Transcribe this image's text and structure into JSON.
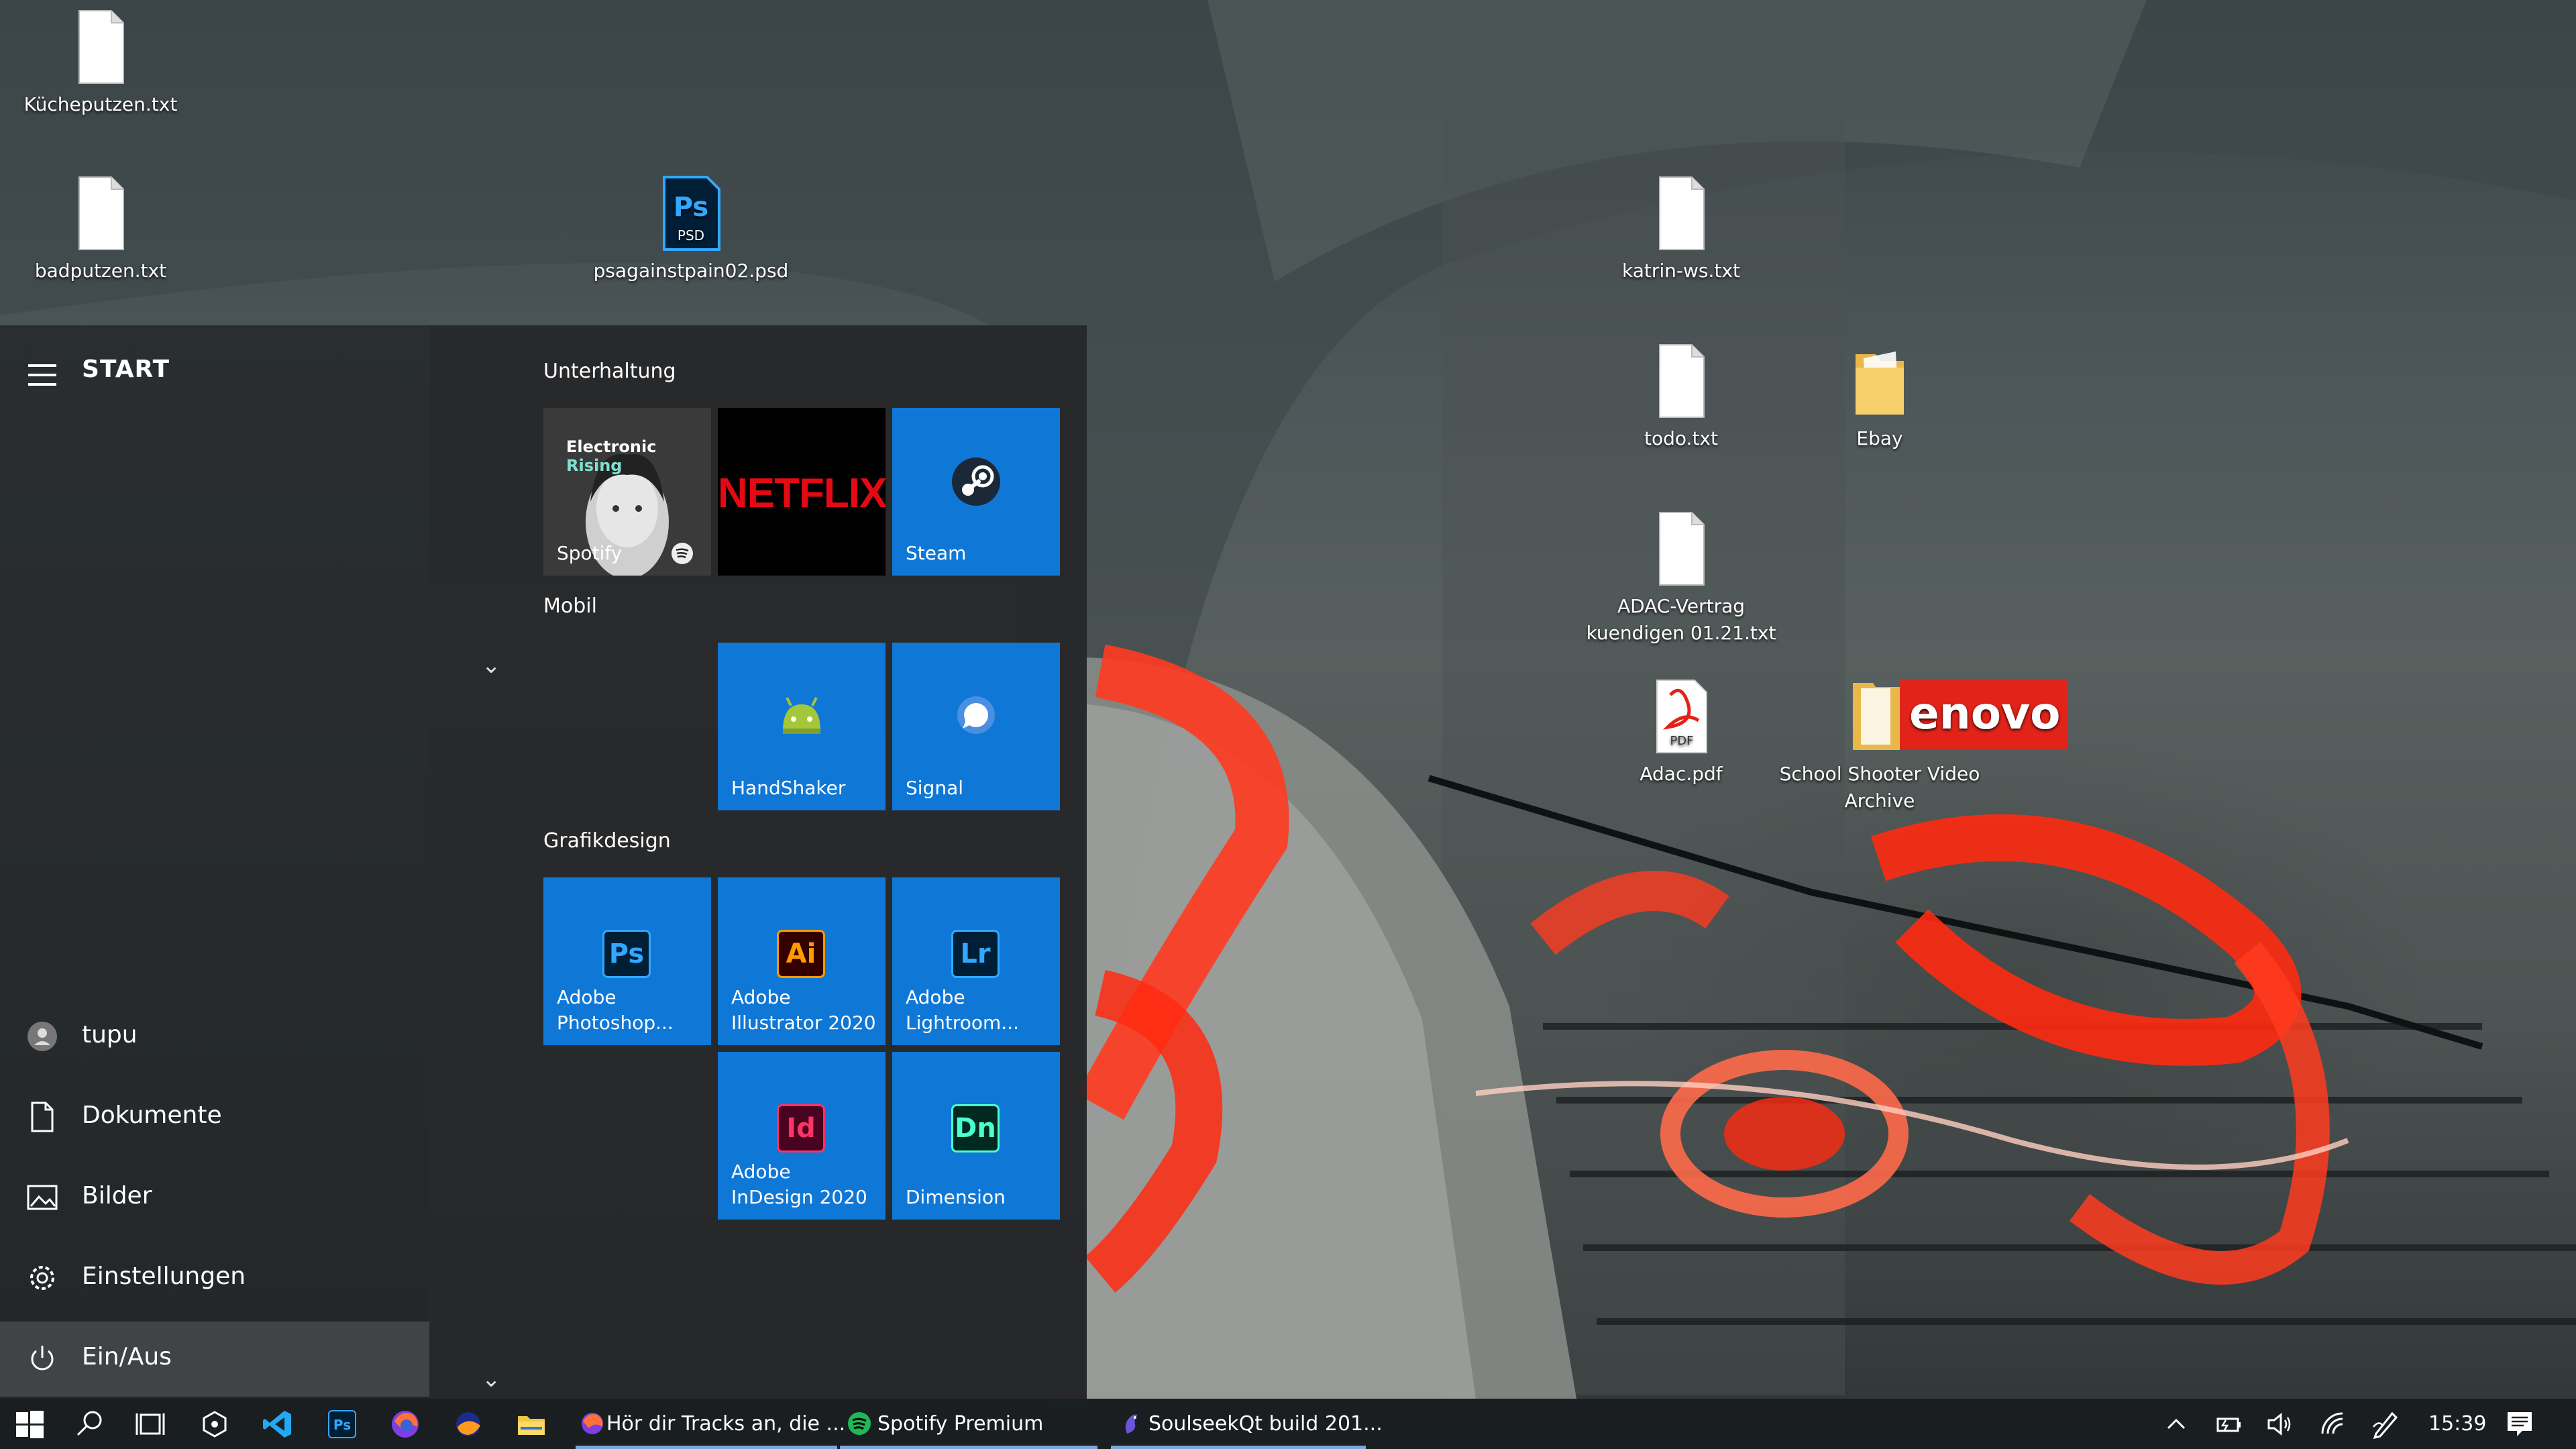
{
  "desktop": {
    "icons": [
      {
        "id": "kuecheputzen",
        "label": "Kücheputzen.txt"
      },
      {
        "id": "badputzen",
        "label": "badputzen.txt"
      },
      {
        "id": "psd",
        "label": "psagainstpain02.psd"
      },
      {
        "id": "katrin",
        "label": "katrin-ws.txt"
      },
      {
        "id": "todo",
        "label": "todo.txt"
      },
      {
        "id": "ebay",
        "label": "Ebay"
      },
      {
        "id": "adac-vertrag",
        "label": "ADAC-Vertrag kuendigen 01.21.txt"
      },
      {
        "id": "adac-pdf",
        "label": "Adac.pdf"
      },
      {
        "id": "school",
        "label": "School Shooter Video Archive"
      }
    ],
    "psd_badge": "PSD",
    "pdf_badge": "PDF",
    "lenovo_text": "enovo"
  },
  "start": {
    "title": "START",
    "user": "tupu",
    "items": [
      {
        "label": "Dokumente"
      },
      {
        "label": "Bilder"
      },
      {
        "label": "Einstellungen"
      },
      {
        "label": "Ein/Aus"
      }
    ],
    "groups": [
      {
        "title": "Unterhaltung"
      },
      {
        "title": "Mobil"
      },
      {
        "title": "Grafikdesign"
      }
    ],
    "tiles": {
      "spotify": {
        "label": "Spotify",
        "banner": "Electronic",
        "banner_accent": "Rising"
      },
      "netflix": {
        "label": "NETFLIX"
      },
      "steam": {
        "label": "Steam"
      },
      "handshaker": {
        "label": "HandShaker"
      },
      "signal": {
        "label": "Signal"
      },
      "photoshop": {
        "label_1": "Adobe",
        "label_2": "Photoshop...",
        "glyph": "Ps"
      },
      "illustrator": {
        "label_1": "Adobe",
        "label_2": "Illustrator 2020",
        "glyph": "Ai"
      },
      "lightroom": {
        "label_1": "Adobe",
        "label_2": "Lightroom...",
        "glyph": "Lr"
      },
      "indesign": {
        "label_1": "Adobe",
        "label_2": "InDesign 2020",
        "glyph": "Id"
      },
      "dimension": {
        "label": "Dimension",
        "glyph": "Dn"
      }
    }
  },
  "taskbar": {
    "tasks": [
      {
        "label": "Hör dir Tracks an, die ..."
      },
      {
        "label": "Spotify Premium"
      },
      {
        "label": "SoulseekQt build 201..."
      }
    ],
    "clock": "15:39",
    "pinned_glyphs": {
      "ps": "Ps"
    }
  },
  "colors": {
    "tile_blue": "#0f78d7",
    "netflix_red": "#e50914",
    "ps_blue": "#31a8ff",
    "ai_orange": "#ff9a00",
    "lr_blue": "#31a8ff",
    "id_pink": "#ff3366",
    "dn_green": "#4bffd0",
    "lenovo_red": "#e2231a"
  }
}
